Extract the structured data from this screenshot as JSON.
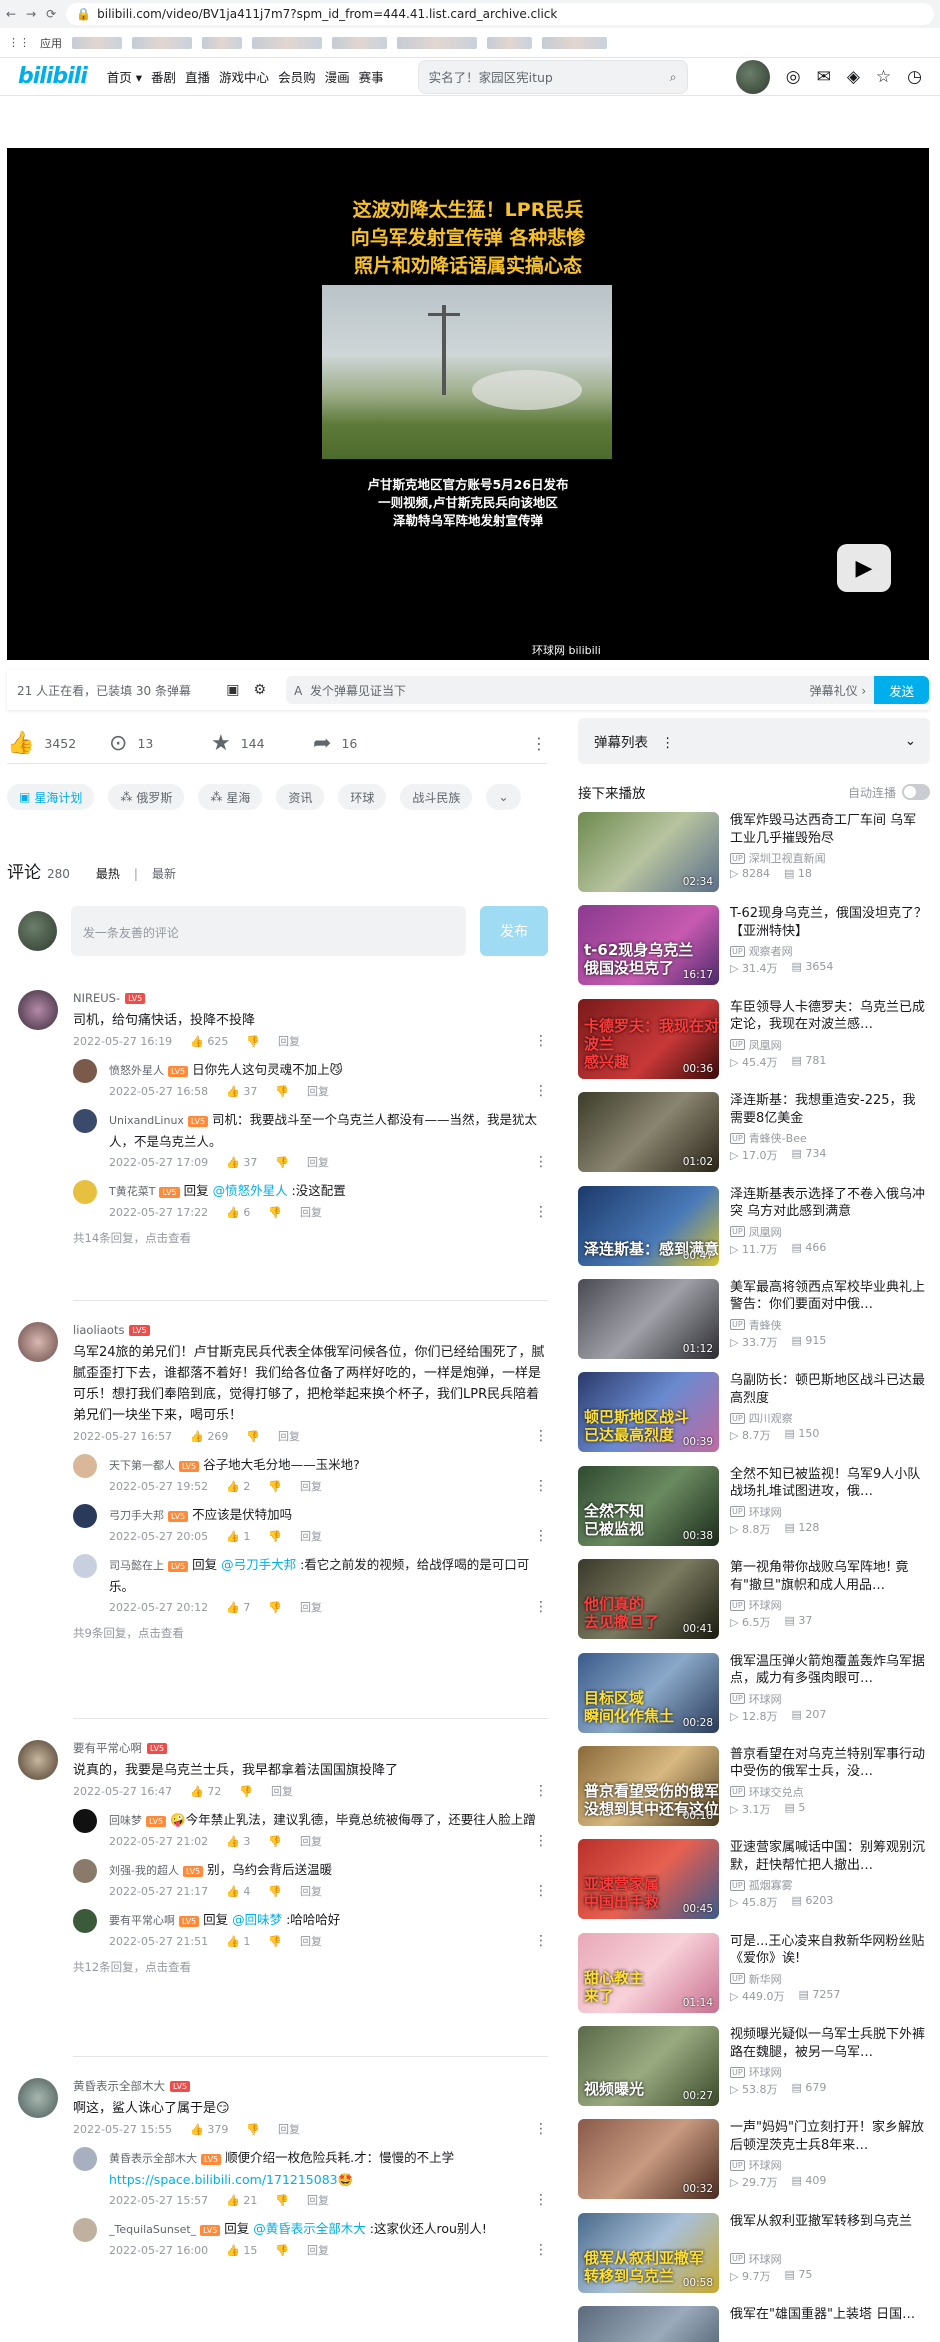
{
  "browser": {
    "url": "bilibili.com/video/BV1ja411j7m7?spm_id_from=444.41.list.card_archive.click",
    "apps": "应用"
  },
  "header": {
    "logo": "bilibili",
    "nav": [
      "首页",
      "番剧",
      "直播",
      "游戏中心",
      "会员购",
      "漫画",
      "赛事"
    ],
    "search_placeholder": "实名了！家园区宪itup"
  },
  "player": {
    "title_lines": [
      "这波劝降太生猛！LPR民兵",
      "向乌军发射宣传弹 各种悲惨",
      "照片和劝降话语属实搞心态"
    ],
    "caption_lines": [
      "卢甘斯克地区官方账号5月26日发布",
      "一则视频,卢甘斯克民兵向该地区",
      "泽勒特乌军阵地发射宣传弹"
    ],
    "watermark": "环球网 bilibili"
  },
  "danmaku_bar": {
    "live": "21 人正在看，已装填 30 条弹幕",
    "placeholder": "发个弹幕见证当下",
    "etiquette": "弹幕礼仪 ›",
    "send": "发送"
  },
  "actions": {
    "like": "3452",
    "coin": "13",
    "fav": "144",
    "share": "16"
  },
  "tags": [
    "星海计划",
    "俄罗斯",
    "星海",
    "资讯",
    "环球",
    "战斗民族"
  ],
  "comments": {
    "title": "评论",
    "count": "280",
    "sort_hot": "最热",
    "sort_new": "最新",
    "placeholder": "发一条友善的评论",
    "publish": "发布"
  },
  "threads": [
    {
      "user": "NIREUS-",
      "lv": "LV5",
      "text": "司机，给句痛快话，投降不投降",
      "time": "2022-05-27 16:19",
      "likes": "625",
      "reply": "回复",
      "replies": [
        {
          "user": "愤怒外星人",
          "lv": "LV5",
          "text": "日你先人这句灵魂不加上😼",
          "time": "2022-05-27 16:58",
          "likes": "37"
        },
        {
          "user": "UnixandLinux",
          "lv": "LV5",
          "text": "司机：我要战斗至一个乌克兰人都没有——当然，我是犹太人，不是乌克兰人。",
          "time": "2022-05-27 17:09",
          "likes": "37"
        },
        {
          "user": "T黄花菜T",
          "lv": "LV5",
          "pre": "回复 ",
          "at": "@愤怒外星人",
          "text": " :没这配置",
          "time": "2022-05-27 17:22",
          "likes": "6"
        }
      ],
      "more": "共14条回复，点击查看"
    },
    {
      "user": "liaoliaots",
      "lv": "LV5",
      "text": "乌军24旅的弟兄们！卢甘斯克民兵代表全体俄军问候各位，你们已经给围死了，腻腻歪歪打下去，谁都落不着好！我们给各位备了两样好吃的，一样是炮弹，一样是可乐！想打我们奉陪到底，觉得打够了，把枪举起来换个杯子，我们LPR民兵陪着弟兄们一块坐下来，喝可乐！",
      "time": "2022-05-27 16:57",
      "likes": "269",
      "reply": "回复",
      "replies": [
        {
          "user": "天下第一都人",
          "lv": "LV5",
          "text": "谷子地大毛分地——玉米地?",
          "time": "2022-05-27 19:52",
          "likes": "2"
        },
        {
          "user": "弓刀手大邦",
          "lv": "LV5",
          "text": "不应该是伏特加吗",
          "time": "2022-05-27 20:05",
          "likes": "1"
        },
        {
          "user": "司马懿在上",
          "lv": "LV5",
          "pre": "回复 ",
          "at": "@弓刀手大邦",
          "text": " :看它之前发的视频，给战俘喝的是可口可乐。",
          "time": "2022-05-27 20:12",
          "likes": "7"
        }
      ],
      "more": "共9条回复，点击查看"
    },
    {
      "user": "要有平常心啊",
      "lv": "LV5",
      "text": "说真的，我要是乌克兰士兵，我早都拿着法国国旗投降了",
      "time": "2022-05-27 16:47",
      "likes": "72",
      "reply": "回复",
      "replies": [
        {
          "user": "回味梦",
          "lv": "LV5",
          "text": "🤪今年禁止乳法，建议乳德，毕竟总统被侮辱了，还要往人脸上蹭",
          "time": "2022-05-27 21:02",
          "likes": "3"
        },
        {
          "user": "刘强-我的超人",
          "lv": "LV5",
          "text": "别，乌约会背后送温暖",
          "time": "2022-05-27 21:17",
          "likes": "4"
        },
        {
          "user": "要有平常心啊",
          "lv": "LV5",
          "pre": "回复 ",
          "at": "@回味梦",
          "text": " :哈哈哈好",
          "time": "2022-05-27 21:51",
          "likes": "1"
        }
      ],
      "more": "共12条回复，点击查看"
    },
    {
      "user": "黄昏表示全部木大",
      "lv": "LV5",
      "text": "啊这，鲨人诛心了属于是😏",
      "time": "2022-05-27 15:55",
      "likes": "379",
      "reply": "回复",
      "replies": [
        {
          "user": "黄昏表示全部木大",
          "lv": "LV5",
          "text": "顺便介绍一枚危险兵耗.才：慢慢的不上学 ",
          "link": "https://space.bilibili.com/171215083",
          "emo": "🤩",
          "time": "2022-05-27 15:57",
          "likes": "21"
        },
        {
          "user": "_TequilaSunset_",
          "lv": "LV5",
          "pre": "回复 ",
          "at": "@黄昏表示全部木大",
          "text": " :这家伙还人rou别人!",
          "time": "2022-05-27 16:00",
          "likes": "15"
        }
      ],
      "more": ""
    }
  ],
  "sidebar": {
    "danmaku_list": "弹幕列表",
    "up_next": "接下来播放",
    "autoplay": "自动连播"
  },
  "recommendations": [
    {
      "title": "俄军炸毁马达西奇工厂车间 乌军工业几乎摧毁殆尽",
      "up": "深圳卫视直新闻",
      "views": "8284",
      "dm": "18",
      "dur": "02:34",
      "cap": "",
      "bg": "linear-gradient(135deg,#6d8a4f,#b8c4a0 50%,#5a6d8a)"
    },
    {
      "title": "T-62现身乌克兰，俄国没坦克了？【亚洲特快】",
      "up": "观察者网",
      "views": "31.4万",
      "dm": "3654",
      "dur": "16:17",
      "cap": "t-62现身乌克兰\n俄国没坦克了",
      "bg": "linear-gradient(135deg,#8a3a8f,#c75ab0 60%,#4a2a6a)"
    },
    {
      "title": "车臣领导人卡德罗夫：乌克兰已成定论，我现在对波兰感…",
      "up": "凤凰网",
      "views": "45.4万",
      "dm": "781",
      "dur": "00:36",
      "cap": "卡德罗夫：我现在对波兰\n感兴趣",
      "bg": "linear-gradient(135deg,#7a1a1a,#c83838 60%,#3a0a0a)"
    },
    {
      "title": "泽连斯基：我想重造安-225，我需要8亿美金",
      "up": "青蜂侠-Bee",
      "views": "17.0万",
      "dm": "734",
      "dur": "01:02",
      "cap": "",
      "bg": "linear-gradient(135deg,#3b3c2a,#8a8570 50%,#2a2418)"
    },
    {
      "title": "泽连斯基表示选择了不卷入俄乌冲突 乌方对此感到满意",
      "up": "凤凰网",
      "views": "11.7万",
      "dm": "466",
      "dur": "00:47",
      "cap": "泽连斯基：感到满意",
      "bg": "linear-gradient(135deg,#1c3a6a,#4a7ab8 60%,#d8c430)"
    },
    {
      "title": "美军最高将领西点军校毕业典礼上警告：你们要面对中俄…",
      "up": "青蜂侠",
      "views": "33.7万",
      "dm": "915",
      "dur": "01:12",
      "cap": "",
      "bg": "linear-gradient(135deg,#4a4a52,#a0a0a8 50%,#2a2a30)"
    },
    {
      "title": "乌副防长：顿巴斯地区战斗已达最高烈度",
      "up": "四川观察",
      "views": "8.7万",
      "dm": "150",
      "dur": "00:39",
      "cap": "顿巴斯地区战斗\n已达最高烈度",
      "bg": "linear-gradient(135deg,#2a3a6a,#6a8ad0 50%,#c06aa0)"
    },
    {
      "title": "全然不知已被监视！乌军9人小队战场扎堆试图进攻，俄…",
      "up": "环球网",
      "views": "8.8万",
      "dm": "128",
      "dur": "00:38",
      "cap": "全然不知\n已被监视",
      "bg": "linear-gradient(135deg,#2f4a30,#6a8a60 50%,#1a2a1a)"
    },
    {
      "title": "第一视角带你战败乌军阵地! 竟有\"撤旦\"旗帜和成人用品…",
      "up": "环球网",
      "views": "6.5万",
      "dm": "37",
      "dur": "00:41",
      "cap": "他们真的\n去见撤旦了",
      "bg": "linear-gradient(135deg,#3a3a2a,#7a7a60 50%,#1a1a10)"
    },
    {
      "title": "俄军温压弹火箭炮覆盖轰炸乌军据点，威力有多强肉眼可…",
      "up": "环球网",
      "views": "12.8万",
      "dm": "207",
      "dur": "00:28",
      "cap": "目标区域\n瞬间化作焦土",
      "bg": "linear-gradient(135deg,#3a5a8a,#8aa8c8 50%,#2a3a5a)"
    },
    {
      "title": "普京看望在对乌克兰特别军事行动中受伤的俄军士兵，没…",
      "up": "环球交兑点",
      "views": "3.1万",
      "dm": "5",
      "dur": "00:18",
      "cap": "普京看望受伤的俄军\n没想到其中还有这位",
      "bg": "linear-gradient(135deg,#8a6a3a,#d8b880 50%,#4a3a20)"
    },
    {
      "title": "亚速营家属喊话中国：别筹观别沉默，赶快帮忙把人撤出…",
      "up": "孤烟寡雾",
      "views": "45.8万",
      "dm": "6203",
      "dur": "00:45",
      "cap": "亚速营家属\n中国出手救",
      "bg": "linear-gradient(135deg,#b8302a,#e86050 50%,#3a5a8a)"
    },
    {
      "title": "可是...王心凌来自救新华网粉丝贴《爱你》诶!",
      "up": "新华网",
      "views": "449.0万",
      "dm": "7257",
      "dur": "01:14",
      "cap": "甜心教主\n来了",
      "bg": "linear-gradient(135deg,#e8a8b8,#f8d0d8 50%,#c87090)"
    },
    {
      "title": "视频曝光疑似一乌军士兵脱下外裤路在魏腿，被另一乌军…",
      "up": "环球网",
      "views": "53.8万",
      "dm": "679",
      "dur": "00:27",
      "cap": "视频曝光",
      "bg": "linear-gradient(135deg,#5a6a4a,#9aaa80 50%,#3a4a2a)"
    },
    {
      "title": "一声\"妈妈\"门立刻打开！家乡解放后顿涅茨克士兵8年来…",
      "up": "环球网",
      "views": "29.7万",
      "dm": "409",
      "dur": "00:32",
      "cap": "",
      "bg": "linear-gradient(135deg,#8a5a4a,#c89a80 50%,#4a2a20)"
    },
    {
      "title": "俄军从叙利亚撤军转移到乌克兰",
      "up": "环球网",
      "views": "9.7万",
      "dm": "75",
      "dur": "00:58",
      "cap": "俄军从叙利亚撤军\n转移到乌克兰",
      "bg": "linear-gradient(135deg,#4a6a8a,#a8c0d8 50%,#c8a830)"
    },
    {
      "title": "俄军在\"雄国重器\"上装塔 日国…",
      "up": "",
      "views": "",
      "dm": "",
      "dur": "",
      "cap": "",
      "bg": "linear-gradient(135deg,#5a6a7a,#9aaabb 50%,#3a4a5a)"
    }
  ]
}
